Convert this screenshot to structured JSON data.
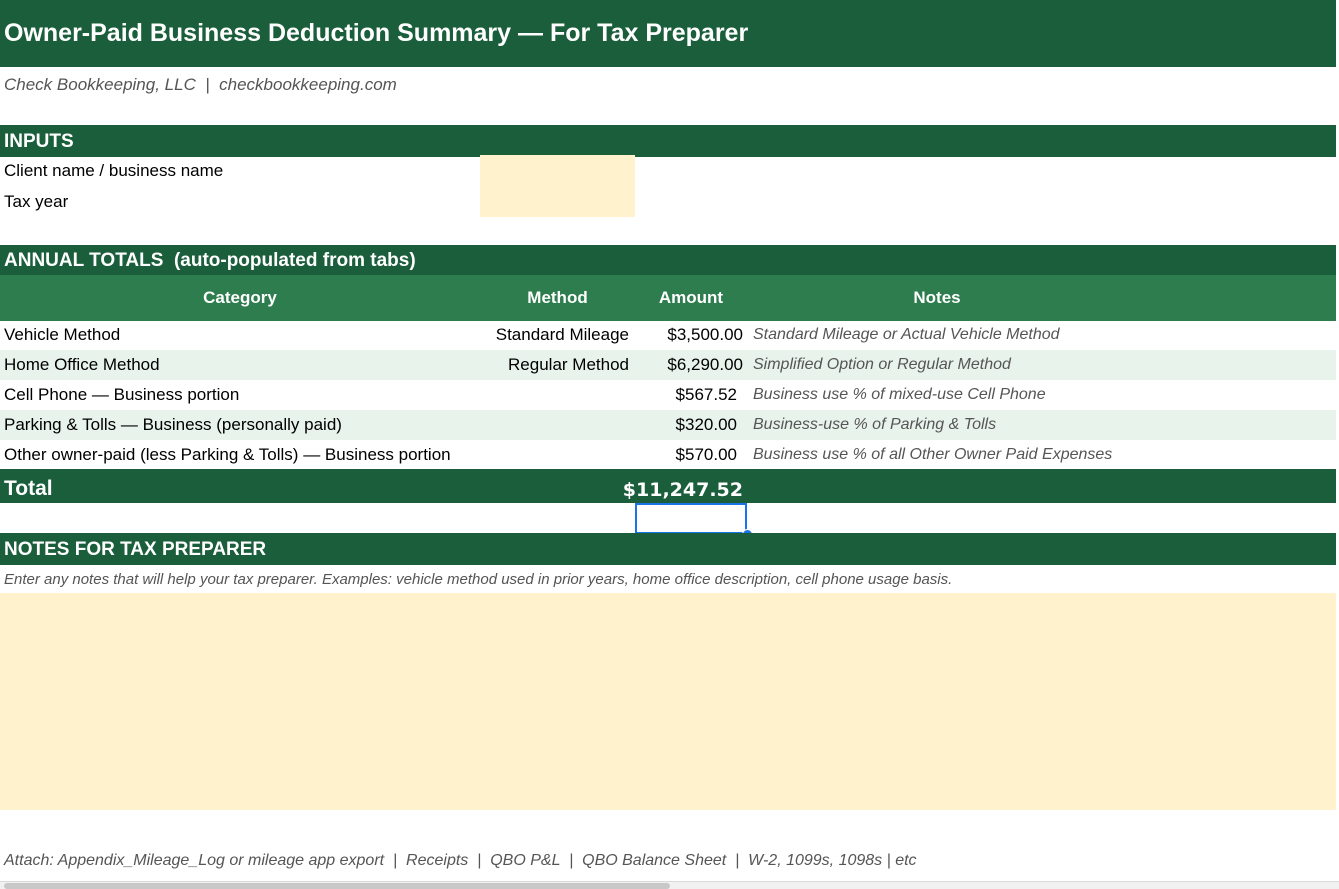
{
  "title": "Owner-Paid Business Deduction Summary — For Tax Preparer",
  "subtitle": "Check Bookkeeping, LLC  |  checkbookkeeping.com",
  "inputs": {
    "heading": "INPUTS",
    "client_label": "Client name / business name",
    "client_value": "",
    "year_label": "Tax year",
    "year_value": ""
  },
  "totals": {
    "heading": "ANNUAL TOTALS  (auto-populated from tabs)",
    "columns": {
      "category": "Category",
      "method": "Method",
      "amount": "Amount",
      "notes": "Notes"
    },
    "rows": [
      {
        "category": "Vehicle Method",
        "method": "Standard Mileage",
        "amount": "$3,500.00",
        "notes": "Standard Mileage or Actual Vehicle Method"
      },
      {
        "category": "Home Office Method",
        "method": "Regular Method",
        "amount": "$6,290.00",
        "notes": "Simplified Option or Regular Method"
      },
      {
        "category": "Cell Phone — Business portion",
        "method": "",
        "amount": "$567.52",
        "notes": "Business use % of mixed-use Cell Phone"
      },
      {
        "category": "Parking & Tolls — Business (personally paid)",
        "method": "",
        "amount": "$320.00",
        "notes": "Business-use % of Parking & Tolls"
      },
      {
        "category": "Other owner-paid (less Parking & Tolls) — Business portion",
        "method": "",
        "amount": "$570.00",
        "notes": "Business use % of all Other Owner Paid Expenses"
      }
    ],
    "total_label": "Total",
    "total_value": "$11,247.52"
  },
  "notes": {
    "heading": "NOTES FOR TAX PREPARER",
    "hint": "Enter any notes that will help your tax preparer. Examples: vehicle method used in prior years, home office description, cell phone usage basis.",
    "value": ""
  },
  "attach": "Attach: Appendix_Mileage_Log or mileage app export  |  Receipts  |  QBO P&L  |  QBO Balance Sheet  |  W-2, 1099s, 1098s | etc",
  "colors": {
    "dark_green": "#1b5e3b",
    "mid_green": "#2e7d4f",
    "input_fill": "#fff2cc",
    "alt_row": "#e8f3ec",
    "selection": "#1a73e8"
  }
}
